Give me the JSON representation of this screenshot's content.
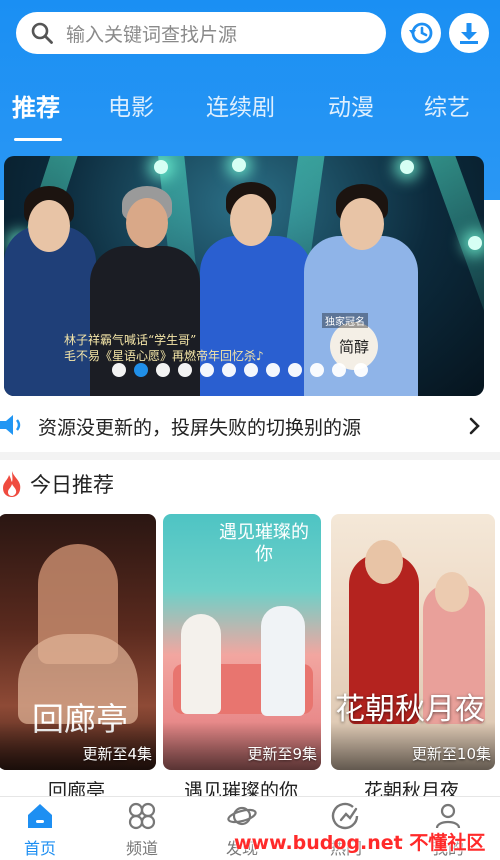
{
  "search": {
    "placeholder": "输入关键词查找片源"
  },
  "tabs": [
    "推荐",
    "电影",
    "连续剧",
    "动漫",
    "综艺"
  ],
  "banner": {
    "caption_line1": "林子祥霸气喊话“学生哥”",
    "caption_line2": "毛不易《星语心愿》再燃帝年回忆杀♪",
    "badge": "独家冠名",
    "logo_text": "简醇",
    "dot_count": 12,
    "active_dot": 1
  },
  "notice": {
    "text": "资源没更新的，投屏失败的切换别的源"
  },
  "section": {
    "title": "今日推荐"
  },
  "cards": [
    {
      "title": "回廊亭",
      "poster_text": "回廊亭",
      "update": "更新至4集"
    },
    {
      "title": "遇见璀璨的你",
      "poster_text": "遇见璀璨的你",
      "update": "更新至9集"
    },
    {
      "title": "花朝秋月夜",
      "poster_text": "花朝秋月夜",
      "update": "更新至10集"
    }
  ],
  "nav": [
    {
      "label": "首页",
      "icon": "home-icon",
      "active": true
    },
    {
      "label": "频道",
      "icon": "channel-icon",
      "active": false
    },
    {
      "label": "发现",
      "icon": "planet-icon",
      "active": false
    },
    {
      "label": "热门",
      "icon": "trending-icon",
      "active": false
    },
    {
      "label": "我的",
      "icon": "user-icon",
      "active": false
    }
  ],
  "watermark": "www.budog.net 不懂社区",
  "colors": {
    "primary": "#1e8ff2",
    "notice_icon": "#2196f3",
    "fire_icon": "#ef4b3f"
  }
}
